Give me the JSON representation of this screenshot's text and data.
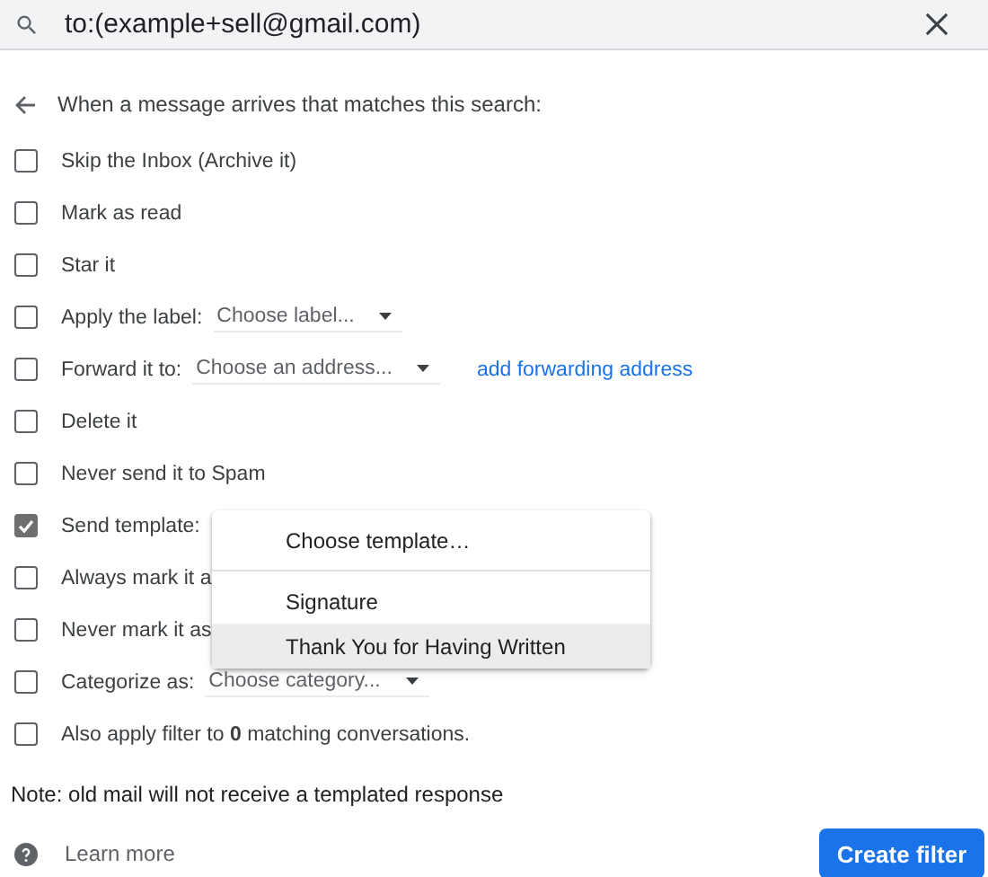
{
  "search": {
    "value": "to:(example+sell@gmail.com)"
  },
  "heading": "When a message arrives that matches this search:",
  "options": [
    {
      "kind": "plain",
      "label": "Skip the Inbox (Archive it)",
      "checked": false
    },
    {
      "kind": "plain",
      "label": "Mark as read",
      "checked": false
    },
    {
      "kind": "plain",
      "label": "Star it",
      "checked": false
    },
    {
      "kind": "select",
      "label": "Apply the label:",
      "select": "Choose label...",
      "checked": false
    },
    {
      "kind": "select",
      "label": "Forward it to:",
      "select": "Choose an address...",
      "link": "add forwarding address",
      "checked": false
    },
    {
      "kind": "plain",
      "label": "Delete it",
      "checked": false
    },
    {
      "kind": "plain",
      "label": "Never send it to Spam",
      "checked": false
    },
    {
      "kind": "plain",
      "label": "Send template:",
      "checked": true
    },
    {
      "kind": "plain",
      "label": "Always mark it a",
      "checked": false
    },
    {
      "kind": "plain",
      "label": "Never mark it as",
      "checked": false
    },
    {
      "kind": "select",
      "label": "Categorize as:",
      "select": "Choose category...",
      "checked": false
    },
    {
      "kind": "plain",
      "label": "Also apply filter to **0** matching conversations.",
      "checked": false
    }
  ],
  "menu": {
    "items": [
      {
        "label": "Choose template…",
        "selected": false,
        "divider_after": true
      },
      {
        "label": "Signature",
        "selected": false
      },
      {
        "label": "Thank You for Having Written",
        "selected": true
      }
    ]
  },
  "note": "Note: old mail will not receive a templated response",
  "footer": {
    "help": "Learn more",
    "button": "Create filter"
  }
}
